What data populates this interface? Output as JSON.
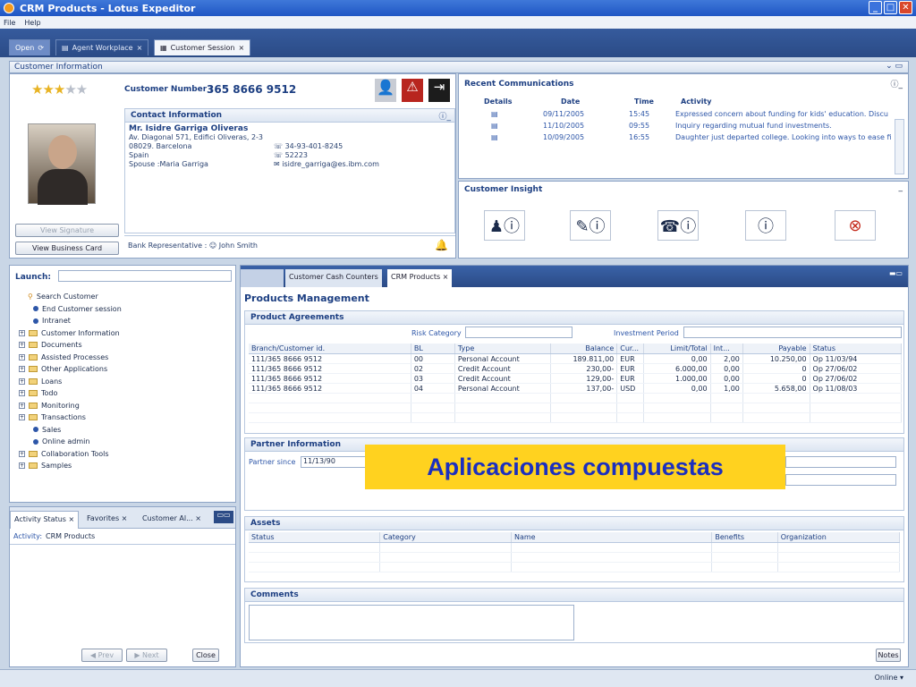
{
  "window": {
    "title": "CRM Products - Lotus Expeditor"
  },
  "menu": [
    "File",
    "Help"
  ],
  "tabs": {
    "open": "Open",
    "agent": "Agent Workplace",
    "session": "Customer Session"
  },
  "customer_info": {
    "header": "Customer Information",
    "rating": 3,
    "customer_number_label": "Customer Number :",
    "customer_number": "365 8666 9512",
    "contact_header": "Contact Information",
    "name": "Mr. Isidre Garriga Oliveras",
    "address1": "Av. Diagonal 571, Edifici Oliveras, 2-3",
    "address2": "08029. Barcelona",
    "country": "Spain",
    "spouse": "Spouse :Maria Garriga",
    "phone": "34-93-401-8245",
    "fax": "52223",
    "email": "isidre_garriga@es.ibm.com",
    "view_signature": "View Signature",
    "view_business_card": "View Business Card",
    "bank_rep_label": "Bank Representative :",
    "bank_rep": "John Smith"
  },
  "recent": {
    "header": "Recent Communications",
    "columns": [
      "Details",
      "Date",
      "Time",
      "Activity"
    ],
    "rows": [
      {
        "date": "09/11/2005",
        "time": "15:45",
        "activity": "Expressed concern about funding for kids' education. Discu"
      },
      {
        "date": "11/10/2005",
        "time": "09:55",
        "activity": "Inquiry regarding mutual fund investments."
      },
      {
        "date": "10/09/2005",
        "time": "16:55",
        "activity": "Daughter just departed college. Looking into ways to ease fi"
      }
    ]
  },
  "insight": {
    "header": "Customer Insight"
  },
  "launch": {
    "label": "Launch:",
    "items": [
      {
        "kind": "search",
        "label": "Search Customer"
      },
      {
        "kind": "bullet",
        "label": "End Customer session"
      },
      {
        "kind": "bullet",
        "label": "Intranet"
      },
      {
        "kind": "folder",
        "label": "Customer Information"
      },
      {
        "kind": "folder",
        "label": "Documents"
      },
      {
        "kind": "folder",
        "label": "Assisted Processes"
      },
      {
        "kind": "folder",
        "label": "Other Applications"
      },
      {
        "kind": "folder",
        "label": "Loans"
      },
      {
        "kind": "folder",
        "label": "Todo"
      },
      {
        "kind": "folder",
        "label": "Monitoring"
      },
      {
        "kind": "folder",
        "label": "Transactions"
      },
      {
        "kind": "bullet",
        "label": "Sales"
      },
      {
        "kind": "bullet",
        "label": "Online admin"
      },
      {
        "kind": "folder",
        "label": "Collaboration Tools"
      },
      {
        "kind": "folder",
        "label": "Samples"
      }
    ]
  },
  "bottom_tabs": [
    "Activity Status",
    "Favorites",
    "Customer Al..."
  ],
  "activity": {
    "label": "Activity:",
    "value": "CRM Products",
    "prev": "Prev",
    "next": "Next",
    "close": "Close"
  },
  "right_tabs": [
    "Customer Cash Counters",
    "CRM Products"
  ],
  "products": {
    "title": "Products Management",
    "agreements_header": "Product Agreements",
    "risk_label": "Risk Category",
    "period_label": "Investment Period",
    "columns": [
      "Branch/Customer id.",
      "BL",
      "Type",
      "Balance",
      "Cur...",
      "Limit/Total",
      "Int...",
      "Payable",
      "Status"
    ],
    "rows": [
      [
        "111/365 8666 9512",
        "00",
        "Personal Account",
        "189.811,00",
        "EUR",
        "0,00",
        "2,00",
        "10.250,00",
        "Op 11/03/94"
      ],
      [
        "111/365 8666 9512",
        "02",
        "Credit Account",
        "230,00-",
        "EUR",
        "6.000,00",
        "0,00",
        "0",
        "Op 27/06/02"
      ],
      [
        "111/365 8666 9512",
        "03",
        "Credit Account",
        "129,00-",
        "EUR",
        "1.000,00",
        "0,00",
        "0",
        "Op 27/06/02"
      ],
      [
        "111/365 8666 9512",
        "04",
        "Personal Account",
        "137,00-",
        "USD",
        "0,00",
        "1,00",
        "5.658,00",
        "Op 11/08/03"
      ]
    ],
    "partner_header": "Partner Information",
    "partner_since_label": "Partner since",
    "partner_since": "11/13/90",
    "assets_header": "Assets",
    "assets_columns": [
      "Status",
      "Category",
      "Name",
      "Benefits",
      "Organization"
    ],
    "comments_header": "Comments",
    "notes": "Notes"
  },
  "status": {
    "online": "Online"
  },
  "overlay": {
    "text": "Aplicaciones compuestas"
  }
}
